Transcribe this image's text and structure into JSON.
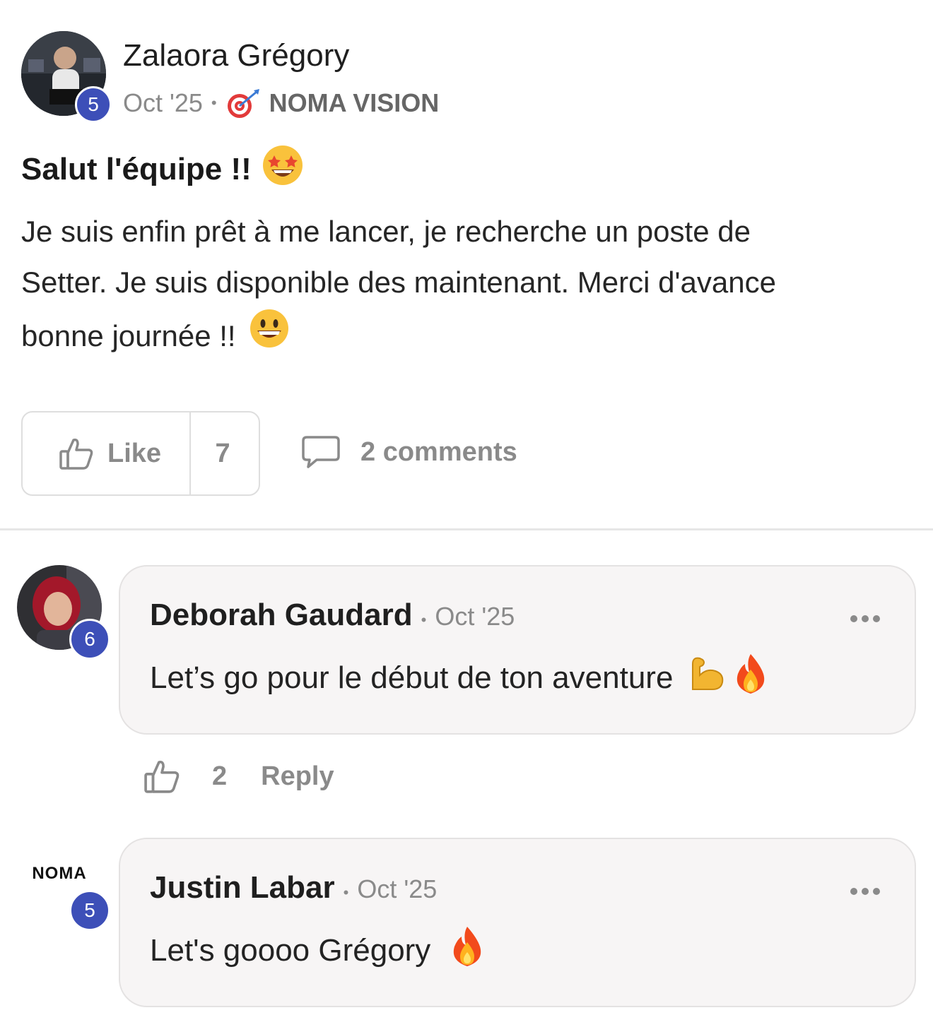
{
  "post": {
    "author": "Zalaora Grégory",
    "level": "5",
    "date": "Oct '25",
    "separator": "•",
    "category": "NOMA VISION",
    "title": "Salut l'équipe !!",
    "body_lines": [
      "Je suis enfin prêt à me lancer, je recherche un poste de",
      "Setter. Je suis disponible des maintenant. Merci d'avance",
      "bonne journée !!"
    ],
    "like_label": "Like",
    "like_count": "7",
    "comments_label": "2 comments"
  },
  "comments": [
    {
      "author": "Deborah Gaudard",
      "level": "6",
      "date": "Oct '25",
      "separator": "•",
      "text": "Let’s go pour le début de ton aventure",
      "likes": "2",
      "reply_label": "Reply"
    },
    {
      "author": "Justin Labar",
      "level": "5",
      "date": "Oct '25",
      "separator": "•",
      "text": "Let's goooo Grégory",
      "avatar_logo": "NOMA"
    }
  ],
  "icons": {
    "category": "target-dart-icon",
    "title_emoji": "star-struck-emoji",
    "body_emoji": "grinning-face-emoji",
    "like": "thumbs-up-outline-icon",
    "comments": "speech-bubble-icon",
    "more": "more-dots-icon",
    "flexed_biceps": "flexed-biceps-emoji",
    "fire": "fire-emoji"
  },
  "colors": {
    "level_badge": "#3d4fb8",
    "muted_text": "#8a8a8a",
    "bubble_bg": "#f7f5f5"
  }
}
